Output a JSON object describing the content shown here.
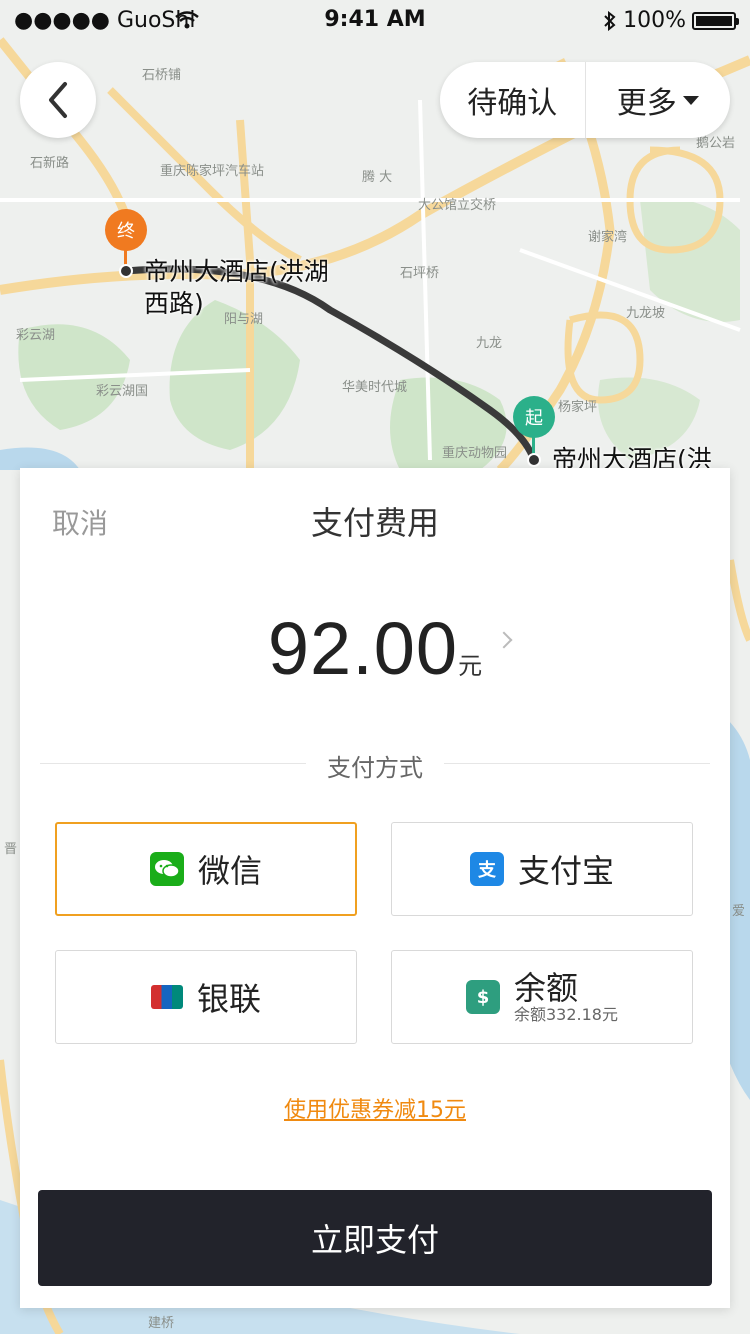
{
  "status_bar": {
    "carrier": "●●●●● GuoShi",
    "time": "9:41 AM",
    "battery": "100%"
  },
  "header": {
    "back_icon": "chevron-left-icon",
    "status_label": "待确认",
    "more_label": "更多"
  },
  "map": {
    "labels": [
      "石桥铺",
      "石新路",
      "重庆陈家坪汽车站",
      "腾 大",
      "大公馆立交桥",
      "谢家湾",
      "石坪桥",
      "彩云湖",
      "彩云湖国",
      "九龙",
      "华美时代城",
      "九龙坡",
      "杨家坪",
      "重庆动物园",
      "鹅公岩",
      "爱",
      "晋",
      "建桥",
      "阳与湖"
    ],
    "end_pin": "终",
    "start_pin": "起",
    "end_place": "帝州大酒店(洪湖西路)",
    "start_place": "帝州大酒店(洪"
  },
  "sheet": {
    "cancel_label": "取消",
    "title": "支付费用",
    "amount": "92.00",
    "amount_unit": "元",
    "method_title": "支付方式",
    "options": [
      {
        "label": "微信",
        "icon": "wechat-icon",
        "color": "#1aad19"
      },
      {
        "label": "支付宝",
        "icon": "alipay-icon",
        "color": "#1e88e5"
      },
      {
        "label": "银联",
        "icon": "unionpay-icon",
        "color": "#d32f2f"
      },
      {
        "label": "余额",
        "sub": "余额332.18元",
        "icon": "wallet-icon",
        "color": "#2e9e7f"
      }
    ],
    "coupon_text": "使用优惠券减15元",
    "pay_label": "立即支付"
  },
  "colors": {
    "accent": "#f0a020",
    "button_bg": "#22232b",
    "end_pin": "#f07a20",
    "start_pin": "#2bb08a"
  }
}
